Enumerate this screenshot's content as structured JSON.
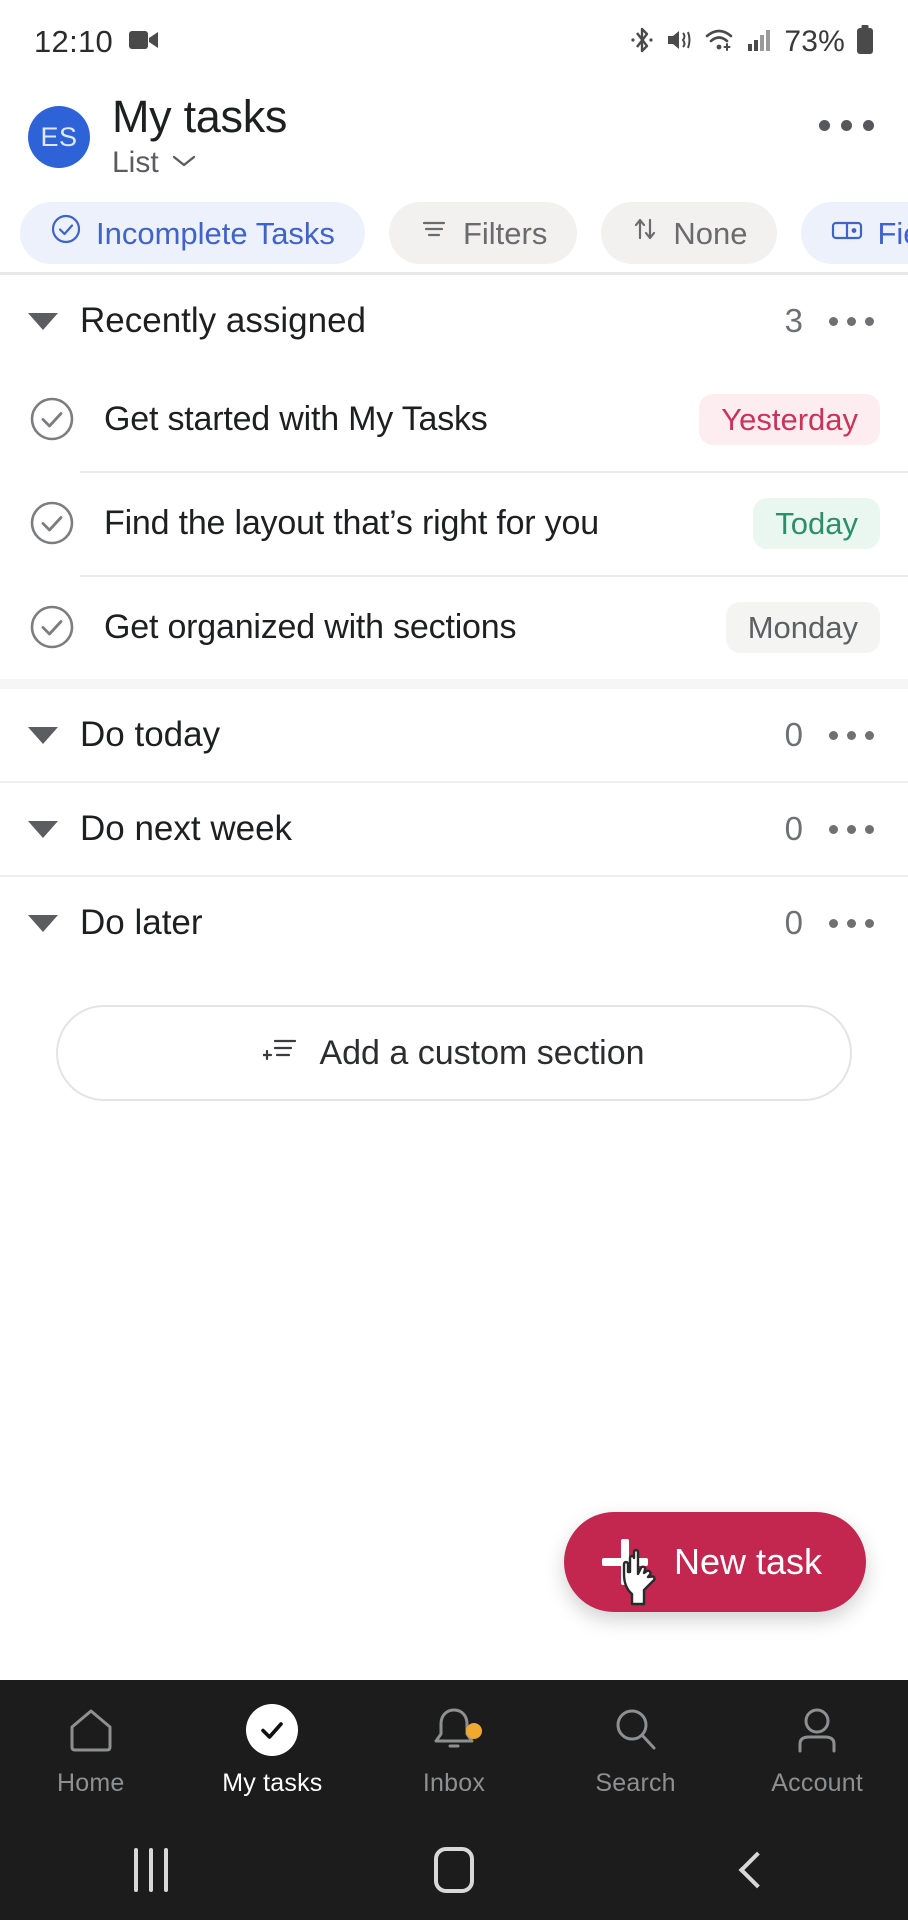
{
  "status_bar": {
    "time": "12:10",
    "battery_percent": "73%",
    "icons": [
      "video-recording-icon",
      "bluetooth-icon",
      "mute-vibrate-icon",
      "wifi-icon",
      "cellular-signal-icon",
      "battery-icon"
    ]
  },
  "header": {
    "avatar_initials": "ES",
    "avatar_color": "#2d63d6",
    "title": "My tasks",
    "view_label": "List",
    "overflow_label": "More options"
  },
  "chips": [
    {
      "label": "Incomplete Tasks",
      "icon": "check-circle-icon",
      "style": "blue"
    },
    {
      "label": "Filters",
      "icon": "filter-icon",
      "style": "grey"
    },
    {
      "label": "None",
      "icon": "sort-icon",
      "style": "grey"
    },
    {
      "label": "Fiel",
      "icon": "fields-icon",
      "style": "blue"
    }
  ],
  "sections": [
    {
      "title": "Recently assigned",
      "count": "3",
      "tasks": [
        {
          "title": "Get started with My Tasks",
          "due": "Yesterday",
          "due_style": "red"
        },
        {
          "title": "Find the layout that’s right for you",
          "due": "Today",
          "due_style": "green"
        },
        {
          "title": "Get organized with sections",
          "due": "Monday",
          "due_style": "grey"
        }
      ]
    },
    {
      "title": "Do today",
      "count": "0",
      "tasks": []
    },
    {
      "title": "Do next week",
      "count": "0",
      "tasks": []
    },
    {
      "title": "Do later",
      "count": "0",
      "tasks": []
    }
  ],
  "add_section": {
    "label": "Add a custom section",
    "icon": "add-section-icon"
  },
  "fab": {
    "label": "New task",
    "icon": "plus-icon",
    "color": "#c3264f"
  },
  "bottom_nav": [
    {
      "label": "Home",
      "icon": "home-icon",
      "active": false
    },
    {
      "label": "My tasks",
      "icon": "check-circle-filled-icon",
      "active": true
    },
    {
      "label": "Inbox",
      "icon": "bell-icon",
      "active": false,
      "badge": true
    },
    {
      "label": "Search",
      "icon": "search-icon",
      "active": false
    },
    {
      "label": "Account",
      "icon": "person-icon",
      "active": false
    }
  ],
  "system_nav": [
    {
      "name": "recents-button"
    },
    {
      "name": "home-button"
    },
    {
      "name": "back-button"
    }
  ],
  "colors": {
    "accent_blue": "#3f63c9",
    "fab_crimson": "#c3264f",
    "due_red": "#c9345a",
    "due_green": "#2b8f6a",
    "badge_orange": "#f0a92c"
  }
}
